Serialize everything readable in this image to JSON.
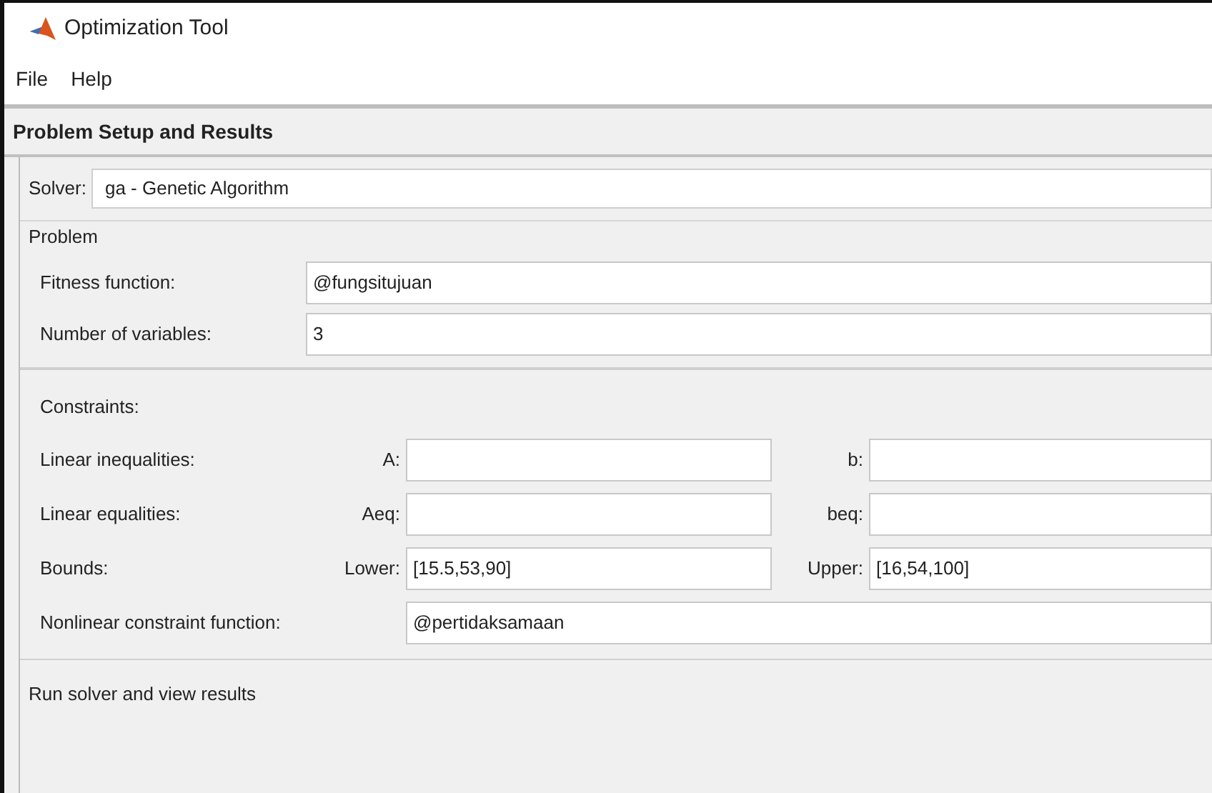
{
  "window": {
    "title": "Optimization Tool"
  },
  "menu": [
    "File",
    "Help"
  ],
  "panel": {
    "title": "Problem Setup and Results"
  },
  "solver": {
    "label": "Solver:",
    "value": "ga - Genetic Algorithm"
  },
  "problem": {
    "title": "Problem",
    "fields": [
      {
        "label": "Fitness function:",
        "value": "@fungsitujuan"
      },
      {
        "label": "Number of variables:",
        "value": "3"
      }
    ]
  },
  "constraints": {
    "title": "Constraints:",
    "rows": [
      {
        "label": "Linear inequalities:",
        "left_label": "A:",
        "left_value": "",
        "right_label": "b:",
        "right_value": ""
      },
      {
        "label": "Linear equalities:",
        "left_label": "Aeq:",
        "left_value": "",
        "right_label": "beq:",
        "right_value": ""
      },
      {
        "label": "Bounds:",
        "left_label": "Lower:",
        "left_value": "[15.5,53,90]",
        "right_label": "Upper:",
        "right_value": "[16,54,100]"
      }
    ],
    "nonlinear": {
      "label": "Nonlinear constraint function:",
      "value": "@pertidaksamaan"
    }
  },
  "run_section": {
    "title": "Run solver and view results"
  }
}
